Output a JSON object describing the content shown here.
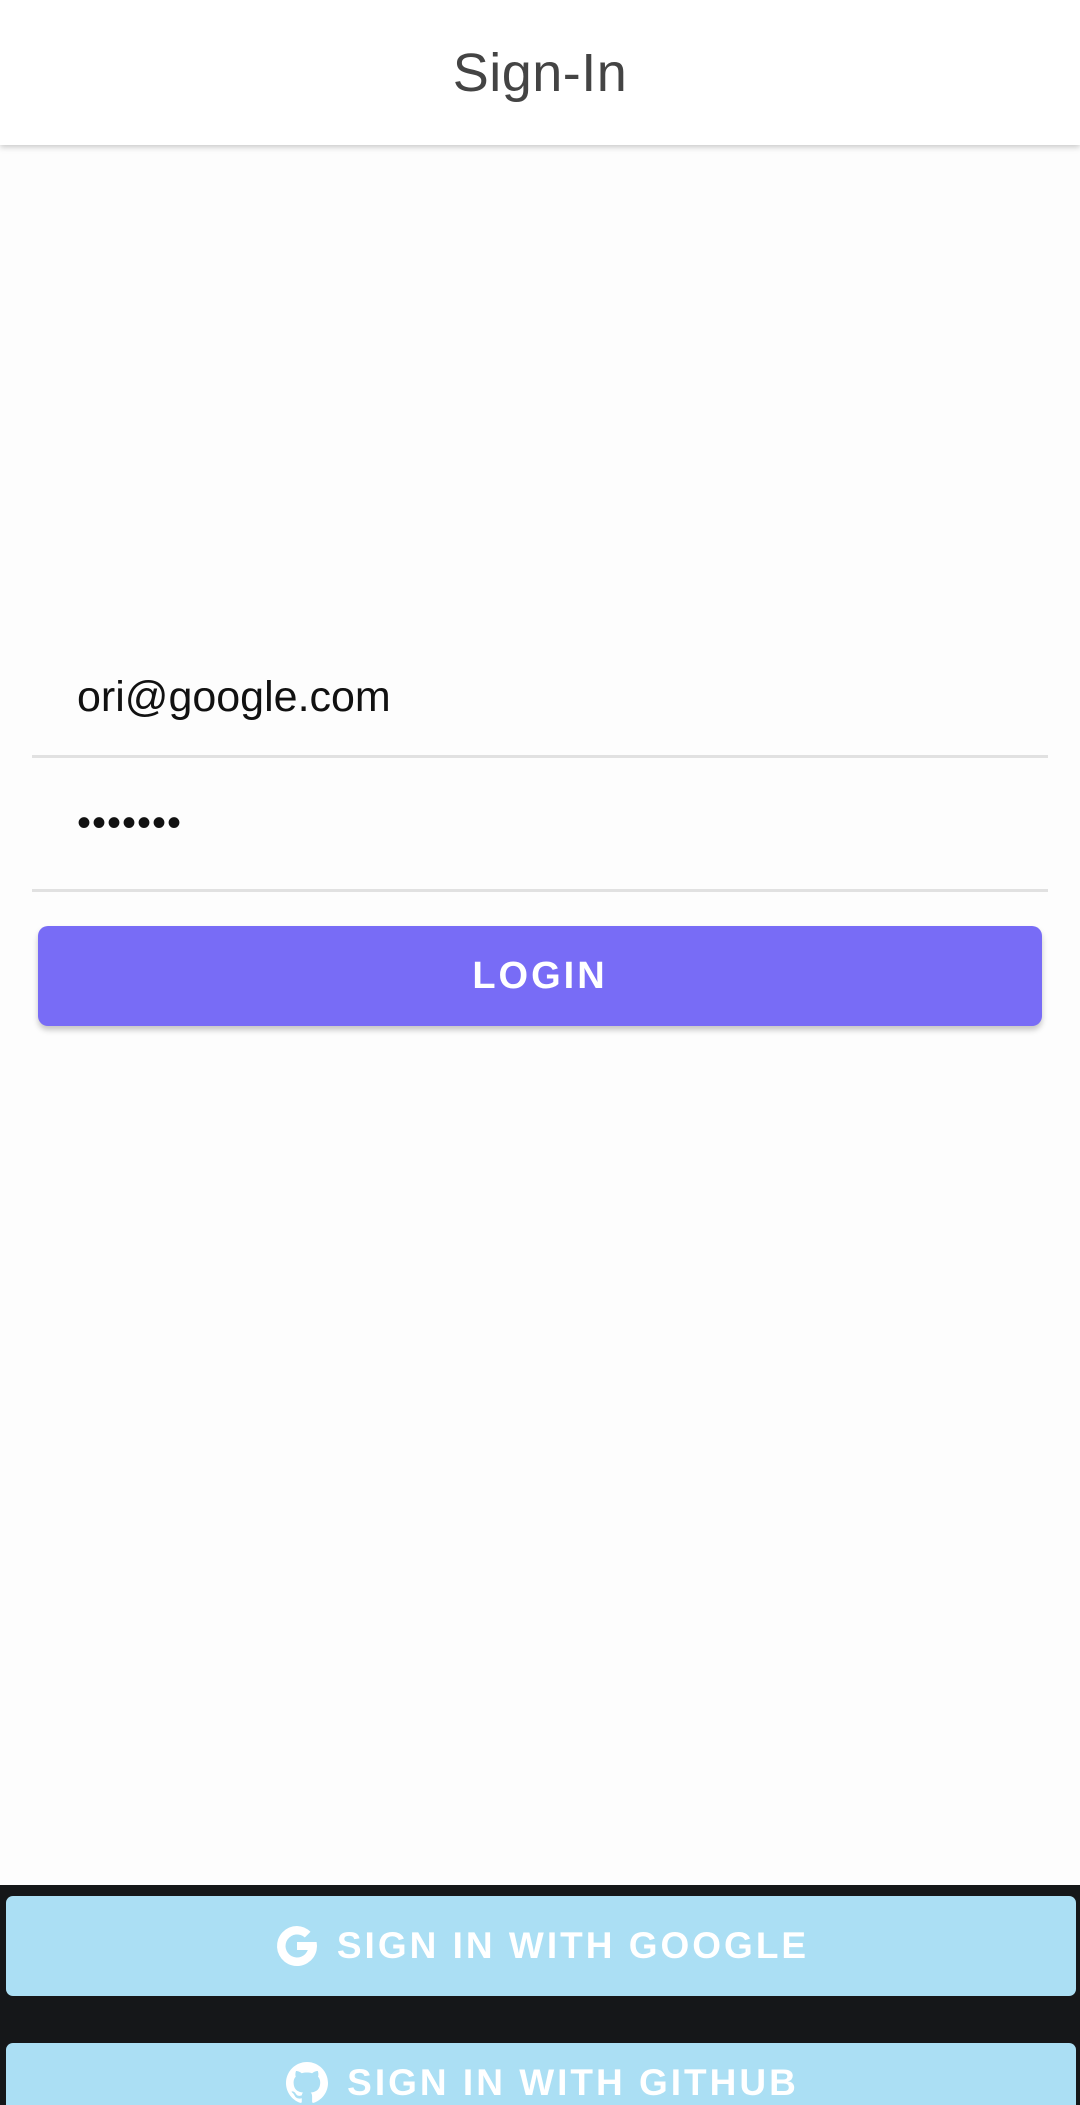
{
  "header": {
    "title": "Sign-In"
  },
  "form": {
    "email": {
      "value": "ori@google.com",
      "placeholder": ""
    },
    "password": {
      "value": "•••••••",
      "placeholder": ""
    },
    "login_label": "LOGIN"
  },
  "social": {
    "google": {
      "label": "SIGN IN WITH GOOGLE",
      "icon": "google-g-icon"
    },
    "github": {
      "label": "SIGN IN WITH GITHUB",
      "icon": "github-icon"
    }
  },
  "colors": {
    "primary": "#786cf6",
    "social_button": "#abdff4",
    "bottom_bar": "#151719",
    "header_text": "#444444"
  }
}
